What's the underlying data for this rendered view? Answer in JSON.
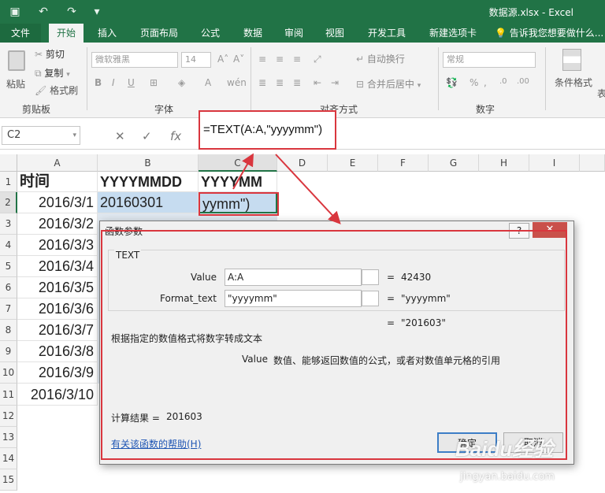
{
  "window": {
    "title": "数据源.xlsx - Excel",
    "quick_access": [
      "save-icon",
      "undo-icon",
      "redo-icon",
      "customize-icon"
    ]
  },
  "ribbon_tabs": [
    {
      "label": "文件"
    },
    {
      "label": "开始",
      "active": true
    },
    {
      "label": "插入"
    },
    {
      "label": "页面布局"
    },
    {
      "label": "公式"
    },
    {
      "label": "数据"
    },
    {
      "label": "审阅"
    },
    {
      "label": "视图"
    },
    {
      "label": "开发工具"
    },
    {
      "label": "新建选项卡"
    },
    {
      "label": "告诉我您想要做什么..."
    }
  ],
  "ribbon": {
    "paste": "粘贴",
    "cut": "剪切",
    "copy": "复制",
    "format_painter": "格式刷",
    "clipboard_group": "剪贴板",
    "font_name": "微软雅黑",
    "font_size": "14",
    "font_group": "字体",
    "wrap_text": "自动换行",
    "merge_center": "合并后居中",
    "alignment_group": "对齐方式",
    "number_format": "常规",
    "number_group": "数字",
    "conditional_format": "条件格式",
    "table_partial": "表"
  },
  "formula_bar": {
    "name_box": "C2",
    "formula": "=TEXT(A:A,\"yyyymm\")"
  },
  "sheet": {
    "columns": [
      "A",
      "B",
      "C",
      "D",
      "E",
      "F",
      "G",
      "H",
      "I"
    ],
    "rows": [
      "1",
      "2",
      "3",
      "4",
      "5",
      "6",
      "7",
      "8",
      "9",
      "10",
      "11",
      "12",
      "13",
      "14",
      "15"
    ],
    "header_row": [
      "时间",
      "YYYYMMDD",
      "YYYYMM"
    ],
    "col_a": [
      "2016/3/1",
      "2016/3/2",
      "2016/3/3",
      "2016/3/4",
      "2016/3/5",
      "2016/3/6",
      "2016/3/7",
      "2016/3/8",
      "2016/3/9",
      "2016/3/10"
    ],
    "b2": "20160301",
    "c2": "yymm\")"
  },
  "dialog": {
    "title": "函数参数",
    "function_name": "TEXT",
    "args": [
      {
        "label": "Value",
        "input": "A:A",
        "result": "42430"
      },
      {
        "label": "Format_text",
        "input": "\"yyyymm\"",
        "result": "\"yyyymm\""
      }
    ],
    "overall_result": "\"201603\"",
    "description": "根据指定的数值格式将数字转成文本",
    "arg_help_name": "Value",
    "arg_help_text": "数值、能够返回数值的公式，或者对数值单元格的引用",
    "calc_result_label": "计算结果 =",
    "calc_result_value": "201603",
    "help_link": "有关该函数的帮助(H)",
    "ok_label": "确定",
    "cancel_label": "取消",
    "help_button": "?",
    "close_button": "✕"
  },
  "watermark": {
    "brand": "Baidu经验",
    "url": "jingyan.baidu.com"
  },
  "colors": {
    "excel_green": "#217346",
    "annotation_red": "#d9363e",
    "selection_blue": "#c6dcf0"
  }
}
